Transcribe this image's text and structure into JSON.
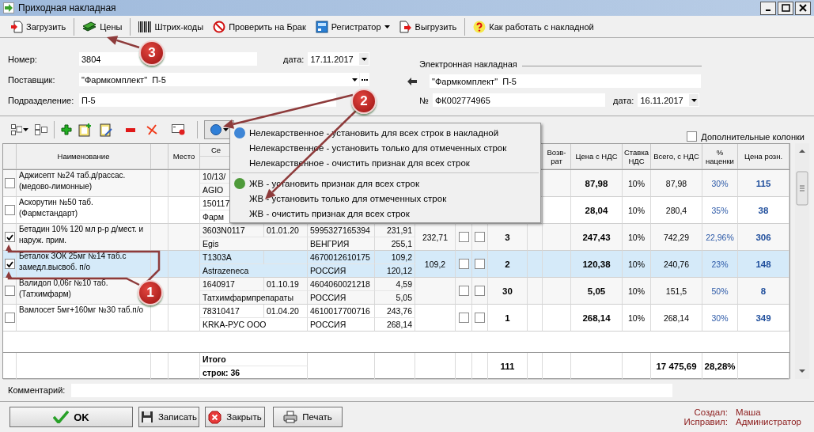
{
  "window": {
    "title": "Приходная накладная"
  },
  "toolbar": [
    {
      "kind": "load",
      "label": "Загрузить",
      "dropdown": false,
      "separator_after": true
    },
    {
      "kind": "prices",
      "label": "Цены",
      "dropdown": false,
      "separator_after": true
    },
    {
      "kind": "barcodes",
      "label": "Штрих-коды",
      "dropdown": false,
      "separator_after": false
    },
    {
      "kind": "reject",
      "label": "Проверить на Брак",
      "dropdown": false,
      "separator_after": false
    },
    {
      "kind": "registrar",
      "label": "Регистратор",
      "dropdown": true,
      "separator_after": false
    },
    {
      "kind": "export",
      "label": "Выгрузить",
      "dropdown": false,
      "separator_after": true
    },
    {
      "kind": "help",
      "label": "Как работать с накладной",
      "dropdown": false,
      "separator_after": false
    }
  ],
  "invoice": {
    "number_label": "Номер:",
    "number": "3804",
    "date_label": "дата:",
    "date": "17.11.2017",
    "supplier_label": "Поставщик:",
    "supplier": "\"Фармкомплект\"  П-5",
    "division_label": "Подразделение:",
    "division": "П-5"
  },
  "electronic_invoice": {
    "title": "Электронная накладная",
    "supplier": "\"Фармкомплект\"  П-5",
    "number_label": "№",
    "number": "ФК002774965",
    "date_label": "дата:",
    "date": "16.11.2017"
  },
  "extra_columns": {
    "label": "Дополнительные колонки",
    "checked": false
  },
  "table": {
    "columns": [
      "Наименование",
      "Место",
      "Се",
      "Возв-рат",
      "Цена с НДС",
      "Ставка НДС",
      "Всего, с НДС",
      "% наценки",
      "Цена розн."
    ],
    "rows": [
      {
        "checked": false,
        "selected": false,
        "name": "Аджисепт №24 таб.д/рассас. (медово-лимонные)",
        "series": "10/13/",
        "manufacturer": "AGIO",
        "price_vat": "87,98",
        "vat_rate": "10%",
        "total": "87,98",
        "markup": "30%",
        "retail": "115"
      },
      {
        "checked": false,
        "selected": false,
        "name": "Аскорутин №50 таб. (Фармстандарт)",
        "series": "150117",
        "manufacturer": "Фарм",
        "price_vat": "28,04",
        "vat_rate": "10%",
        "total": "280,4",
        "markup": "35%",
        "retail": "38"
      },
      {
        "checked": true,
        "selected": false,
        "name": "Бетадин 10% 120 мл р-р д/мест. и наруж. прим.",
        "series": "3603N0117",
        "date": "01.01.20",
        "barcode": "5995327165394",
        "price": "231,91",
        "manufacturer": "Egis",
        "country": "ВЕНГРИЯ",
        "price_2": "255,1",
        "column_9": "232,71",
        "check_a": false,
        "check_b": false,
        "quantity": "3",
        "price_vat": "247,43",
        "vat_rate": "10%",
        "total": "742,29",
        "markup": "22,96%",
        "retail": "306"
      },
      {
        "checked": true,
        "selected": true,
        "name": "Беталок ЗОК 25мг №14  таб.с замедл.высвоб. п/о",
        "series": "T1303A",
        "barcode": "4670012610175",
        "price": "109,2",
        "manufacturer": "Astrazeneca",
        "country": "РОССИЯ",
        "price_2": "120,12",
        "column_9": "109,2",
        "check_a": false,
        "check_b": false,
        "quantity": "2",
        "price_vat": "120,38",
        "vat_rate": "10%",
        "total": "240,76",
        "markup": "23%",
        "retail": "148"
      },
      {
        "checked": false,
        "selected": false,
        "name": "Валидол 0,06г №10 таб. (Татхимфарм)",
        "series": "1640917",
        "date": "01.10.19",
        "barcode": "4604060021218",
        "price": "4,59",
        "manufacturer": "Татхимфармпрепараты",
        "country": "РОССИЯ",
        "price_2": "5,05",
        "check_a": false,
        "check_b": false,
        "quantity": "30",
        "price_vat": "5,05",
        "vat_rate": "10%",
        "total": "151,5",
        "markup": "50%",
        "retail": "8"
      },
      {
        "checked": false,
        "selected": false,
        "name": "Вамлосет 5мг+160мг №30 таб.п/о",
        "series": "78310417",
        "date": "01.04.20",
        "barcode": "4610017700716",
        "price": "243,76",
        "manufacturer": "KRKA-РУС ООО",
        "country": "РОССИЯ",
        "price_2": "268,14",
        "check_a": false,
        "check_b": false,
        "quantity": "1",
        "price_vat": "268,14",
        "vat_rate": "10%",
        "total": "268,14",
        "markup": "30%",
        "retail": "349"
      }
    ],
    "totals": {
      "label": "Итого",
      "rows_count": "строк: 36",
      "quantity": "111",
      "total": "17 475,69",
      "markup": "28,28%"
    }
  },
  "menu": {
    "groups": [
      {
        "color": "#3f86d6",
        "items": [
          "Нелекарственное - установить для всех строк в накладной",
          "Нелекарственное - установить только для отмеченных строк",
          "Нелекарственное - очистить признак для всех строк"
        ]
      },
      {
        "color": "#4e9a3a",
        "items": [
          "ЖВ - установить признак для всех строк",
          "ЖВ - установить только для отмеченных строк",
          "ЖВ - очистить признак для всех строк"
        ]
      }
    ]
  },
  "comment": {
    "label": "Комментарий:"
  },
  "buttons": [
    {
      "kind": "ok",
      "label": "OK"
    },
    {
      "kind": "save",
      "label": "Записать"
    },
    {
      "kind": "close",
      "label": "Закрыть"
    },
    {
      "kind": "print",
      "label": "Печать"
    }
  ],
  "audit": [
    {
      "label": "Создал:",
      "value": "Маша"
    },
    {
      "label": "Исправил:",
      "value": "Администратор"
    }
  ],
  "callouts": [
    "3",
    "2",
    "1"
  ]
}
